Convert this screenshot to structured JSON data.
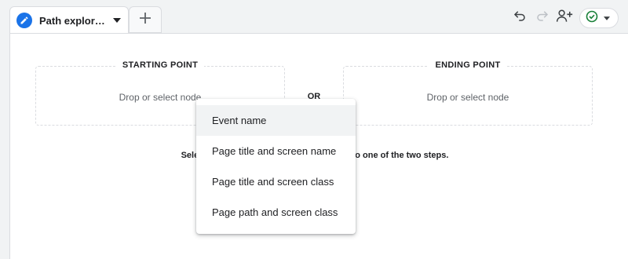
{
  "tabs": {
    "active_label": "Path exploration",
    "add_tab": "+"
  },
  "toolbar": {
    "undo": "undo-icon",
    "redo": "redo-icon",
    "share": "share-user-icon",
    "status": "check-circle-icon"
  },
  "canvas": {
    "starting_point": {
      "title": "STARTING POINT",
      "placeholder": "Drop or select node"
    },
    "ending_point": {
      "title": "ENDING POINT",
      "placeholder": "Drop or select node"
    },
    "or_label": "OR",
    "instruction_left": "Select a node t",
    "instruction_right": "ngs panel to one of the two steps."
  },
  "menu": {
    "items": [
      {
        "label": "Event name"
      },
      {
        "label": "Page title and screen name"
      },
      {
        "label": "Page title and screen class"
      },
      {
        "label": "Page path and screen class"
      }
    ]
  },
  "colors": {
    "accent": "#1a73e8",
    "border": "#dadce0",
    "text": "#202124",
    "muted": "#5f6368"
  }
}
